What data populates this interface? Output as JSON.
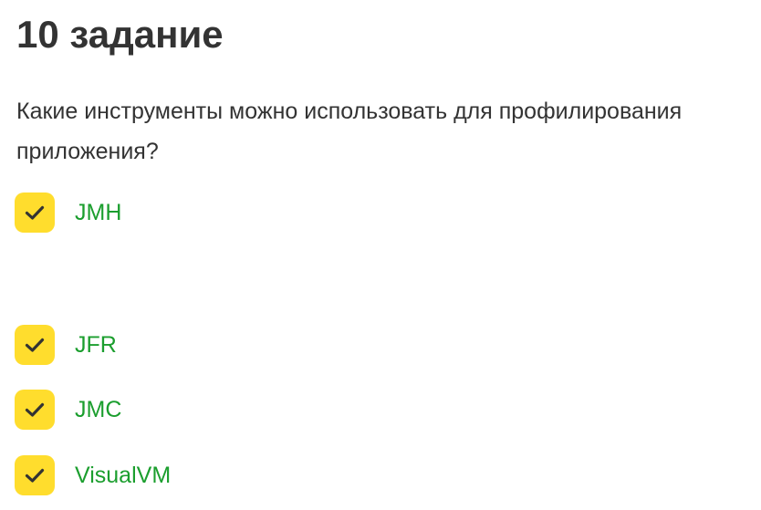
{
  "task": {
    "title": "10 задание",
    "question": "Какие инструменты можно использовать для профилирования приложения?"
  },
  "options": [
    {
      "label": "JMH",
      "checked": true,
      "icon": "checkmark-icon"
    },
    {
      "label": "JFR",
      "checked": true,
      "icon": "checkmark-icon"
    },
    {
      "label": "JMC",
      "checked": true,
      "icon": "checkmark-icon"
    },
    {
      "label": "VisualVM",
      "checked": true,
      "icon": "checkmark-icon"
    }
  ],
  "colors": {
    "checkbox_fill": "#ffdd2d",
    "checkmark": "#333333",
    "option_text": "#1b9e2e",
    "text": "#333333"
  }
}
